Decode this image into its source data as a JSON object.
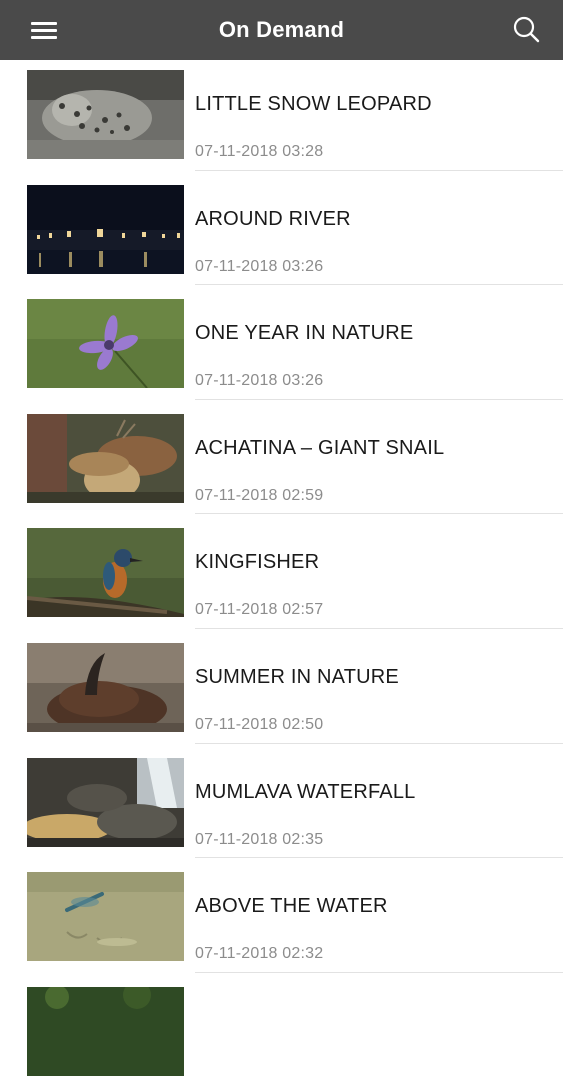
{
  "header": {
    "title": "On Demand",
    "menu_icon": "hamburger-menu-icon",
    "search_icon": "search-icon",
    "background": "#4a4a4a"
  },
  "videos": [
    {
      "title": "LITTLE SNOW LEOPARD",
      "date": "07-11-2018 03:28"
    },
    {
      "title": "AROUND RIVER",
      "date": "07-11-2018 03:26"
    },
    {
      "title": "ONE YEAR IN NATURE",
      "date": "07-11-2018 03:26"
    },
    {
      "title": "ACHATINA – GIANT SNAIL",
      "date": "07-11-2018 02:59"
    },
    {
      "title": "KINGFISHER",
      "date": "07-11-2018 02:57"
    },
    {
      "title": "SUMMER IN NATURE",
      "date": "07-11-2018 02:50"
    },
    {
      "title": "MUMLAVA WATERFALL",
      "date": "07-11-2018 02:35"
    },
    {
      "title": "ABOVE THE WATER",
      "date": "07-11-2018 02:32"
    }
  ]
}
